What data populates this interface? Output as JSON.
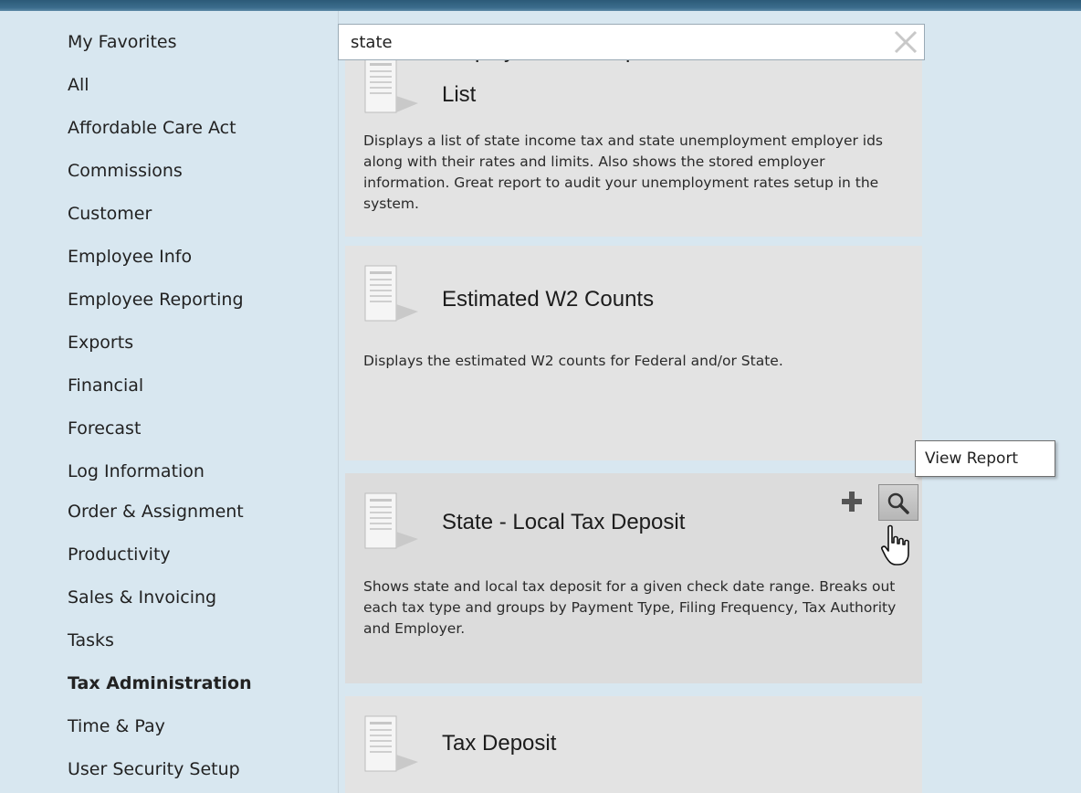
{
  "sidebar": {
    "items": [
      {
        "label": "My Favorites",
        "active": false
      },
      {
        "label": "All",
        "active": false
      },
      {
        "label": "Affordable Care Act",
        "active": false
      },
      {
        "label": "Commissions",
        "active": false
      },
      {
        "label": "Customer",
        "active": false
      },
      {
        "label": "Employee Info",
        "active": false
      },
      {
        "label": "Employee Reporting",
        "active": false
      },
      {
        "label": "Exports",
        "active": false
      },
      {
        "label": "Financial",
        "active": false
      },
      {
        "label": "Forecast",
        "active": false
      },
      {
        "label": "Log Information",
        "active": false
      },
      {
        "label": "Order & Assignment",
        "active": false
      },
      {
        "label": "Productivity",
        "active": false
      },
      {
        "label": "Sales & Invoicing",
        "active": false
      },
      {
        "label": "Tasks",
        "active": false
      },
      {
        "label": "Tax Administration",
        "active": true
      },
      {
        "label": "Time & Pay",
        "active": false
      },
      {
        "label": "User Security Setup",
        "active": false
      }
    ]
  },
  "search": {
    "value": "state",
    "clear_icon": "close-x-icon"
  },
  "results": [
    {
      "title": "Employer Tax Setup Verification List",
      "title_visible": "List",
      "description": "Displays a list of state income tax and state unemployment employer ids along with their rates and limits.  Also shows the stored employer information.  Great report to audit your unemployment rates setup in the system."
    },
    {
      "title": "Estimated W2 Counts",
      "description": "Displays the estimated W2 counts for Federal and/or State."
    },
    {
      "title": "State - Local Tax Deposit",
      "description": "Shows state and local tax deposit for a given check date range.  Breaks out each tax type and groups by Payment Type, Filing Frequency, Tax Authority and Employer."
    },
    {
      "title": "Tax Deposit",
      "description": ""
    }
  ],
  "tooltip": {
    "text": "View Report"
  },
  "icons": {
    "report": "report-document-icon",
    "add": "plus-icon",
    "view": "magnifier-icon",
    "cursor": "hand-pointer-icon"
  },
  "colors": {
    "background": "#d8e7f0",
    "card": "#e3e3e3",
    "topbar": "#3b6c8c"
  }
}
